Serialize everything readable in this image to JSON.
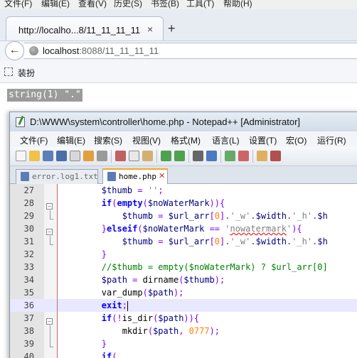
{
  "browser": {
    "menu": [
      "文件(F)",
      "编辑(E)",
      "查看(V)",
      "历史(S)",
      "书签(B)",
      "工具(T)",
      "帮助(H)"
    ],
    "tab_title": "http://localho...8/11_11_11_11",
    "tab_close": "×",
    "new_tab": "+",
    "back": "←",
    "url_host": "localhost",
    "url_rest": ":8088/11_11_11_11",
    "bookmark_label": "装扮"
  },
  "page": {
    "output": "string(1) \".\""
  },
  "npp": {
    "title": "D:\\WWW\\system\\controller\\home.php - Notepad++ [Administrator]",
    "menu": [
      "文件(F)",
      "编辑(E)",
      "搜索(S)",
      "视图(V)",
      "格式(M)",
      "语言(L)",
      "设置(T)",
      "宏(O)",
      "运行(R)"
    ],
    "tabs": [
      {
        "label": "error.log1.txt",
        "active": false
      },
      {
        "label": "home.php",
        "active": true
      }
    ],
    "current_line": 36,
    "lines": [
      {
        "num": "27",
        "text": "        $thumb = '';"
      },
      {
        "num": "28",
        "text": "        if(empty($noWaterMark)){"
      },
      {
        "num": "29",
        "text": "            $thumb = $url_arr[0].'_w'.$width.'_h'.$h"
      },
      {
        "num": "30",
        "text": "        }elseif($noWaterMark == 'nowatermark'){"
      },
      {
        "num": "31",
        "text": "            $thumb = $url_arr[0].'_w'.$width.'_h'.$h"
      },
      {
        "num": "32",
        "text": "        }"
      },
      {
        "num": "33",
        "text": "        //$thumb = empty($noWaterMark) ? $url_arr[0]"
      },
      {
        "num": "34",
        "text": "        $path = dirname($thumb);"
      },
      {
        "num": "35",
        "text": "        var_dump($path);"
      },
      {
        "num": "36",
        "text": "        exit;"
      },
      {
        "num": "37",
        "text": "        if(!is_dir($path)){"
      },
      {
        "num": "38",
        "text": "            mkdir($path, 0777);"
      },
      {
        "num": "39",
        "text": "        }"
      },
      {
        "num": "40",
        "text": "        if(..."
      }
    ]
  },
  "icons": {
    "back": "arrow-left-icon",
    "site": "globe-icon",
    "bookmark": "bookmark-icon",
    "npp_app": "notepadpp-icon",
    "file_tab": "file-icon"
  },
  "colors": {
    "keyword": "#0000ff",
    "variable": "#000080",
    "string": "#808080",
    "number": "#ff8000",
    "comment": "#008000",
    "operator": "#8000ff",
    "current_line": "#e8e8ff",
    "output_bg": "#9b9b9b"
  }
}
